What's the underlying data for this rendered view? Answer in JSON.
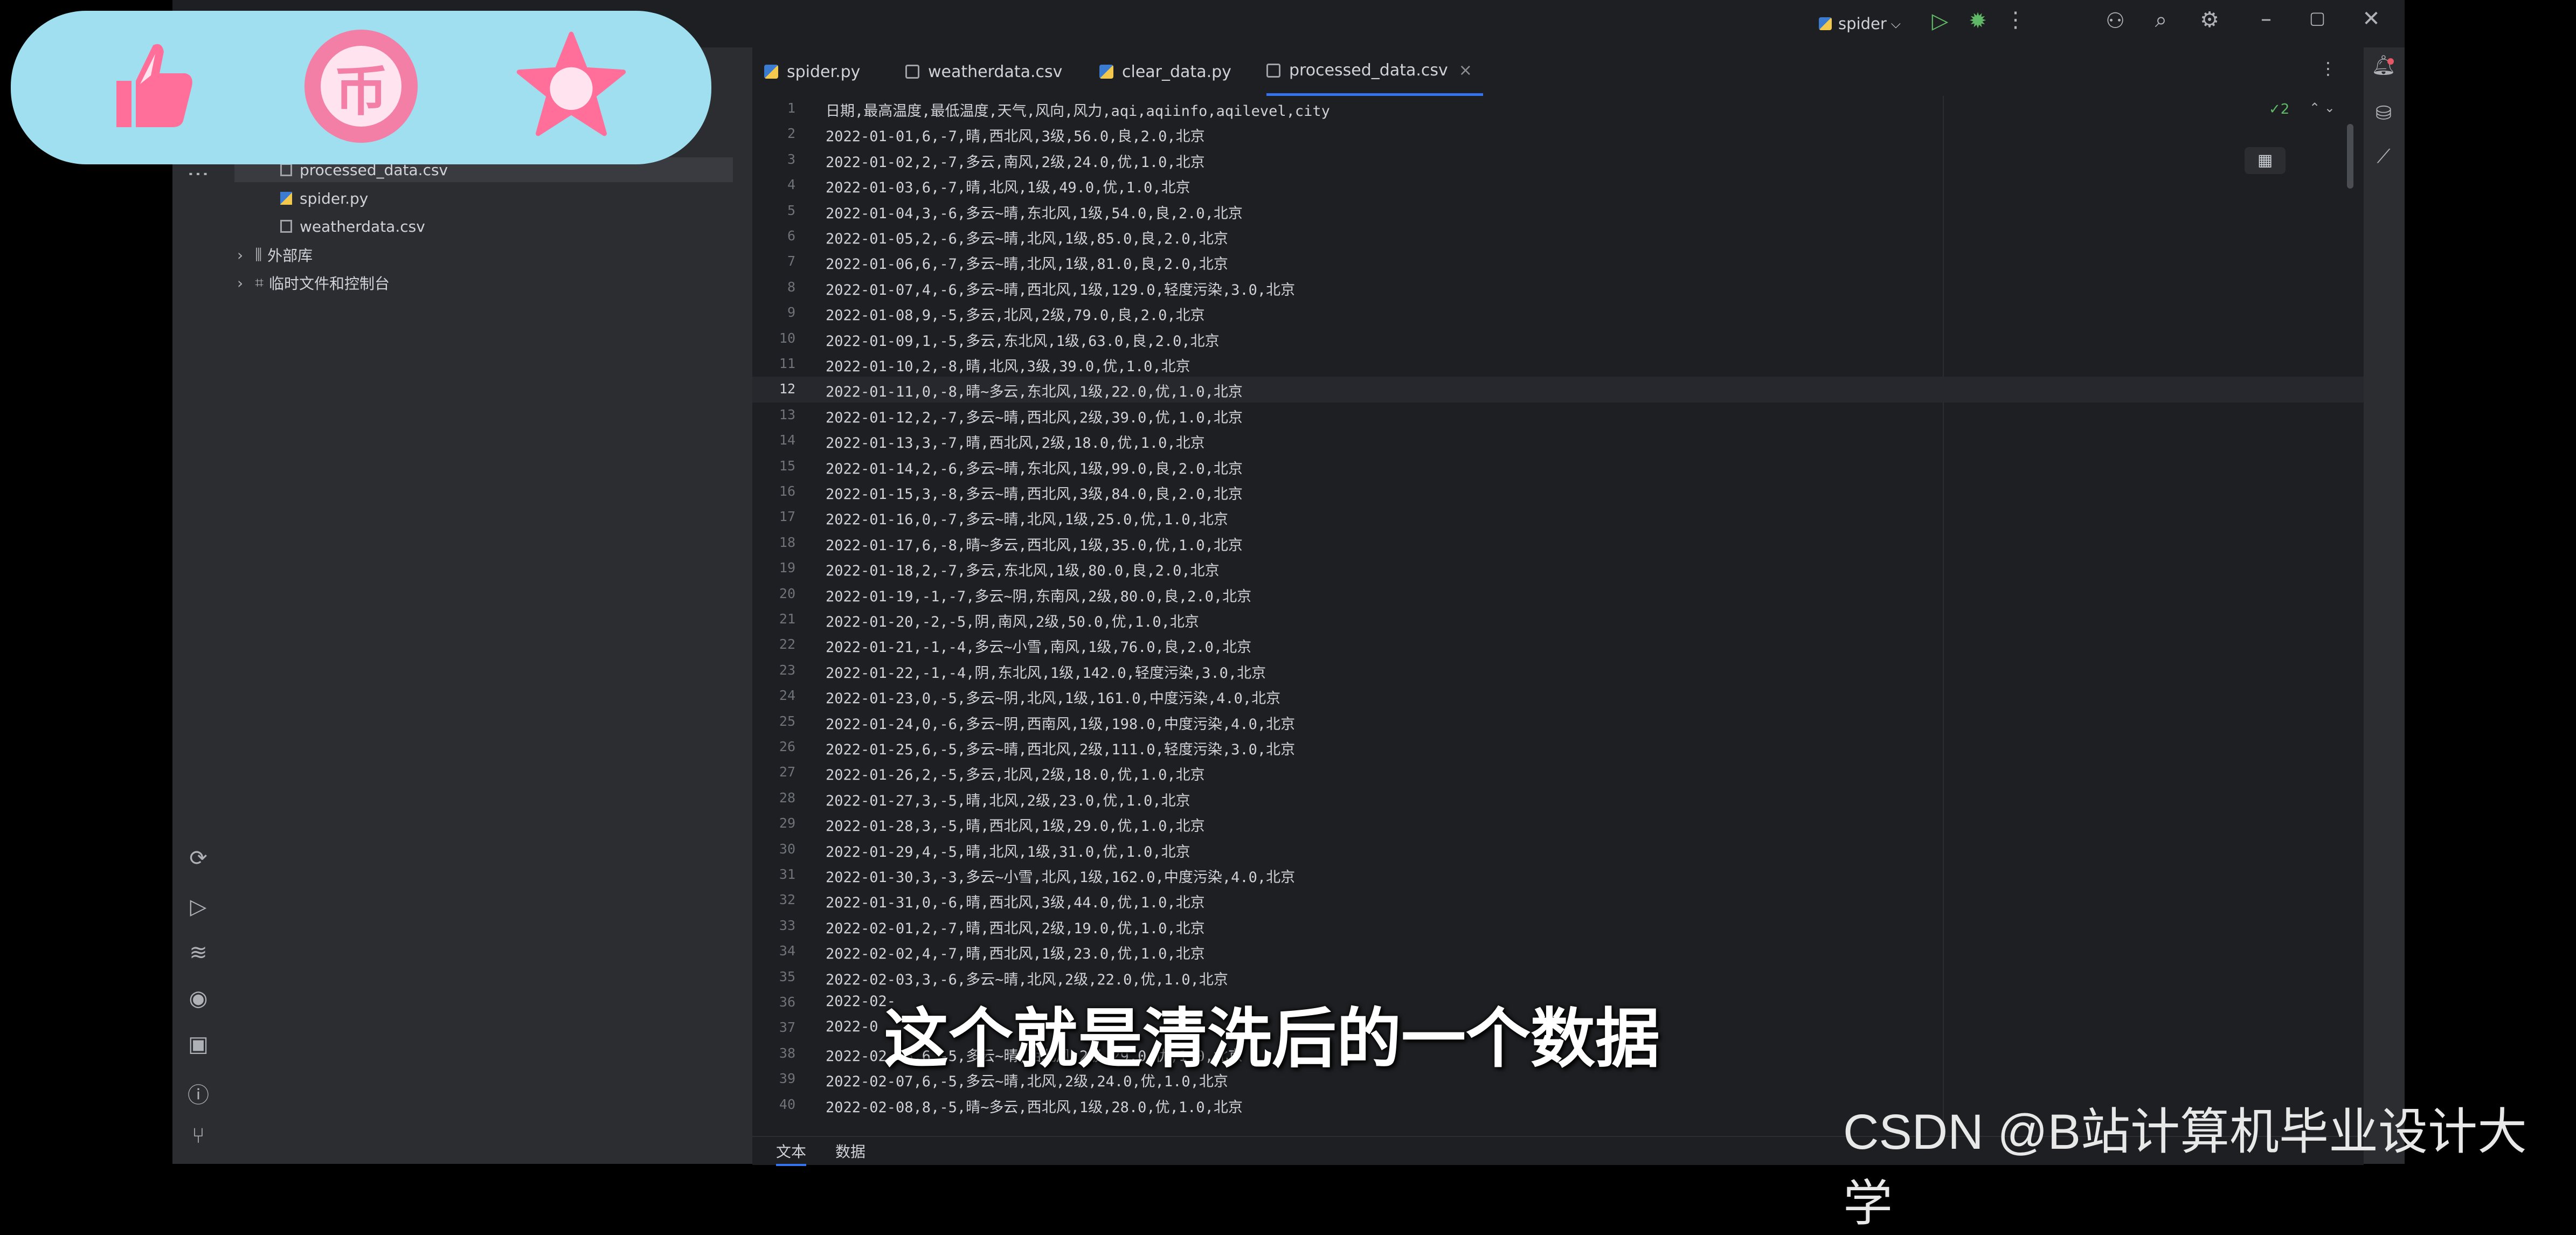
{
  "titlebar": {
    "run_config": "spider",
    "chevron": "⌵"
  },
  "project_tree": [
    {
      "name": "processed_data.csv",
      "type": "csv",
      "selected": true
    },
    {
      "name": "spider.py",
      "type": "py"
    },
    {
      "name": "weatherdata.csv",
      "type": "csv"
    },
    {
      "name": "外部库",
      "type": "lib"
    },
    {
      "name": "临时文件和控制台",
      "type": "scratch"
    }
  ],
  "tabs": [
    {
      "label": "spider.py",
      "icon": "python-file-icon"
    },
    {
      "label": "weatherdata.csv",
      "icon": "csv-file-icon"
    },
    {
      "label": "clear_data.py",
      "icon": "python-file-icon"
    },
    {
      "label": "processed_data.csv",
      "icon": "csv-file-icon",
      "active": true,
      "close": "×"
    }
  ],
  "inspection": "✓2",
  "lines": [
    {
      "n": "1",
      "text": "日期,最高温度,最低温度,天气,风向,风力,aqi,aqiinfo,aqilevel,city"
    },
    {
      "n": "2",
      "text": "2022-01-01,6,-7,晴,西北风,3级,56.0,良,2.0,北京"
    },
    {
      "n": "3",
      "text": "2022-01-02,2,-7,多云,南风,2级,24.0,优,1.0,北京"
    },
    {
      "n": "4",
      "text": "2022-01-03,6,-7,晴,北风,1级,49.0,优,1.0,北京"
    },
    {
      "n": "5",
      "text": "2022-01-04,3,-6,多云~晴,东北风,1级,54.0,良,2.0,北京"
    },
    {
      "n": "6",
      "text": "2022-01-05,2,-6,多云~晴,北风,1级,85.0,良,2.0,北京"
    },
    {
      "n": "7",
      "text": "2022-01-06,6,-7,多云~晴,北风,1级,81.0,良,2.0,北京"
    },
    {
      "n": "8",
      "text": "2022-01-07,4,-6,多云~晴,西北风,1级,129.0,轻度污染,3.0,北京"
    },
    {
      "n": "9",
      "text": "2022-01-08,9,-5,多云,北风,2级,79.0,良,2.0,北京"
    },
    {
      "n": "10",
      "text": "2022-01-09,1,-5,多云,东北风,1级,63.0,良,2.0,北京"
    },
    {
      "n": "11",
      "text": "2022-01-10,2,-8,晴,北风,3级,39.0,优,1.0,北京"
    },
    {
      "n": "12",
      "text": "2022-01-11,0,-8,晴~多云,东北风,1级,22.0,优,1.0,北京"
    },
    {
      "n": "13",
      "text": "2022-01-12,2,-7,多云~晴,西北风,2级,39.0,优,1.0,北京"
    },
    {
      "n": "14",
      "text": "2022-01-13,3,-7,晴,西北风,2级,18.0,优,1.0,北京"
    },
    {
      "n": "15",
      "text": "2022-01-14,2,-6,多云~晴,东北风,1级,99.0,良,2.0,北京"
    },
    {
      "n": "16",
      "text": "2022-01-15,3,-8,多云~晴,西北风,3级,84.0,良,2.0,北京"
    },
    {
      "n": "17",
      "text": "2022-01-16,0,-7,多云~晴,北风,1级,25.0,优,1.0,北京"
    },
    {
      "n": "18",
      "text": "2022-01-17,6,-8,晴~多云,西北风,1级,35.0,优,1.0,北京"
    },
    {
      "n": "19",
      "text": "2022-01-18,2,-7,多云,东北风,1级,80.0,良,2.0,北京"
    },
    {
      "n": "20",
      "text": "2022-01-19,-1,-7,多云~阴,东南风,2级,80.0,良,2.0,北京"
    },
    {
      "n": "21",
      "text": "2022-01-20,-2,-5,阴,南风,2级,50.0,优,1.0,北京"
    },
    {
      "n": "22",
      "text": "2022-01-21,-1,-4,多云~小雪,南风,1级,76.0,良,2.0,北京"
    },
    {
      "n": "23",
      "text": "2022-01-22,-1,-4,阴,东北风,1级,142.0,轻度污染,3.0,北京"
    },
    {
      "n": "24",
      "text": "2022-01-23,0,-5,多云~阴,北风,1级,161.0,中度污染,4.0,北京"
    },
    {
      "n": "25",
      "text": "2022-01-24,0,-6,多云~阴,西南风,1级,198.0,中度污染,4.0,北京"
    },
    {
      "n": "26",
      "text": "2022-01-25,6,-5,多云~晴,西北风,2级,111.0,轻度污染,3.0,北京"
    },
    {
      "n": "27",
      "text": "2022-01-26,2,-5,多云,北风,2级,18.0,优,1.0,北京"
    },
    {
      "n": "28",
      "text": "2022-01-27,3,-5,晴,北风,2级,23.0,优,1.0,北京"
    },
    {
      "n": "29",
      "text": "2022-01-28,3,-5,晴,西北风,1级,29.0,优,1.0,北京"
    },
    {
      "n": "30",
      "text": "2022-01-29,4,-5,晴,北风,1级,31.0,优,1.0,北京"
    },
    {
      "n": "31",
      "text": "2022-01-30,3,-3,多云~小雪,北风,1级,162.0,中度污染,4.0,北京"
    },
    {
      "n": "32",
      "text": "2022-01-31,0,-6,晴,西北风,3级,44.0,优,1.0,北京"
    },
    {
      "n": "33",
      "text": "2022-02-01,2,-7,晴,西北风,2级,19.0,优,1.0,北京"
    },
    {
      "n": "34",
      "text": "2022-02-02,4,-7,晴,西北风,1级,23.0,优,1.0,北京"
    },
    {
      "n": "35",
      "text": "2022-02-03,3,-6,多云~晴,北风,2级,22.0,优,1.0,北京"
    },
    {
      "n": "36",
      "text": "2022-02-"
    },
    {
      "n": "37",
      "text": "2022-0"
    },
    {
      "n": "38",
      "text": "2022-02-06,6,-5,多云~晴,西北风,2级,29.0,优,1.0,北京"
    },
    {
      "n": "39",
      "text": "2022-02-07,6,-5,多云~晴,北风,2级,24.0,优,1.0,北京"
    },
    {
      "n": "40",
      "text": "2022-02-08,8,-5,晴~多云,西北风,1级,28.0,优,1.0,北京"
    }
  ],
  "bottom_tabs": [
    "文本",
    "数据"
  ],
  "subtitle": "这个就是清洗后的一个数据",
  "watermark": "CSDN @B站计算机毕业设计大学",
  "overlay": {
    "coin_glyph": "币"
  },
  "left_dots": "⋮"
}
